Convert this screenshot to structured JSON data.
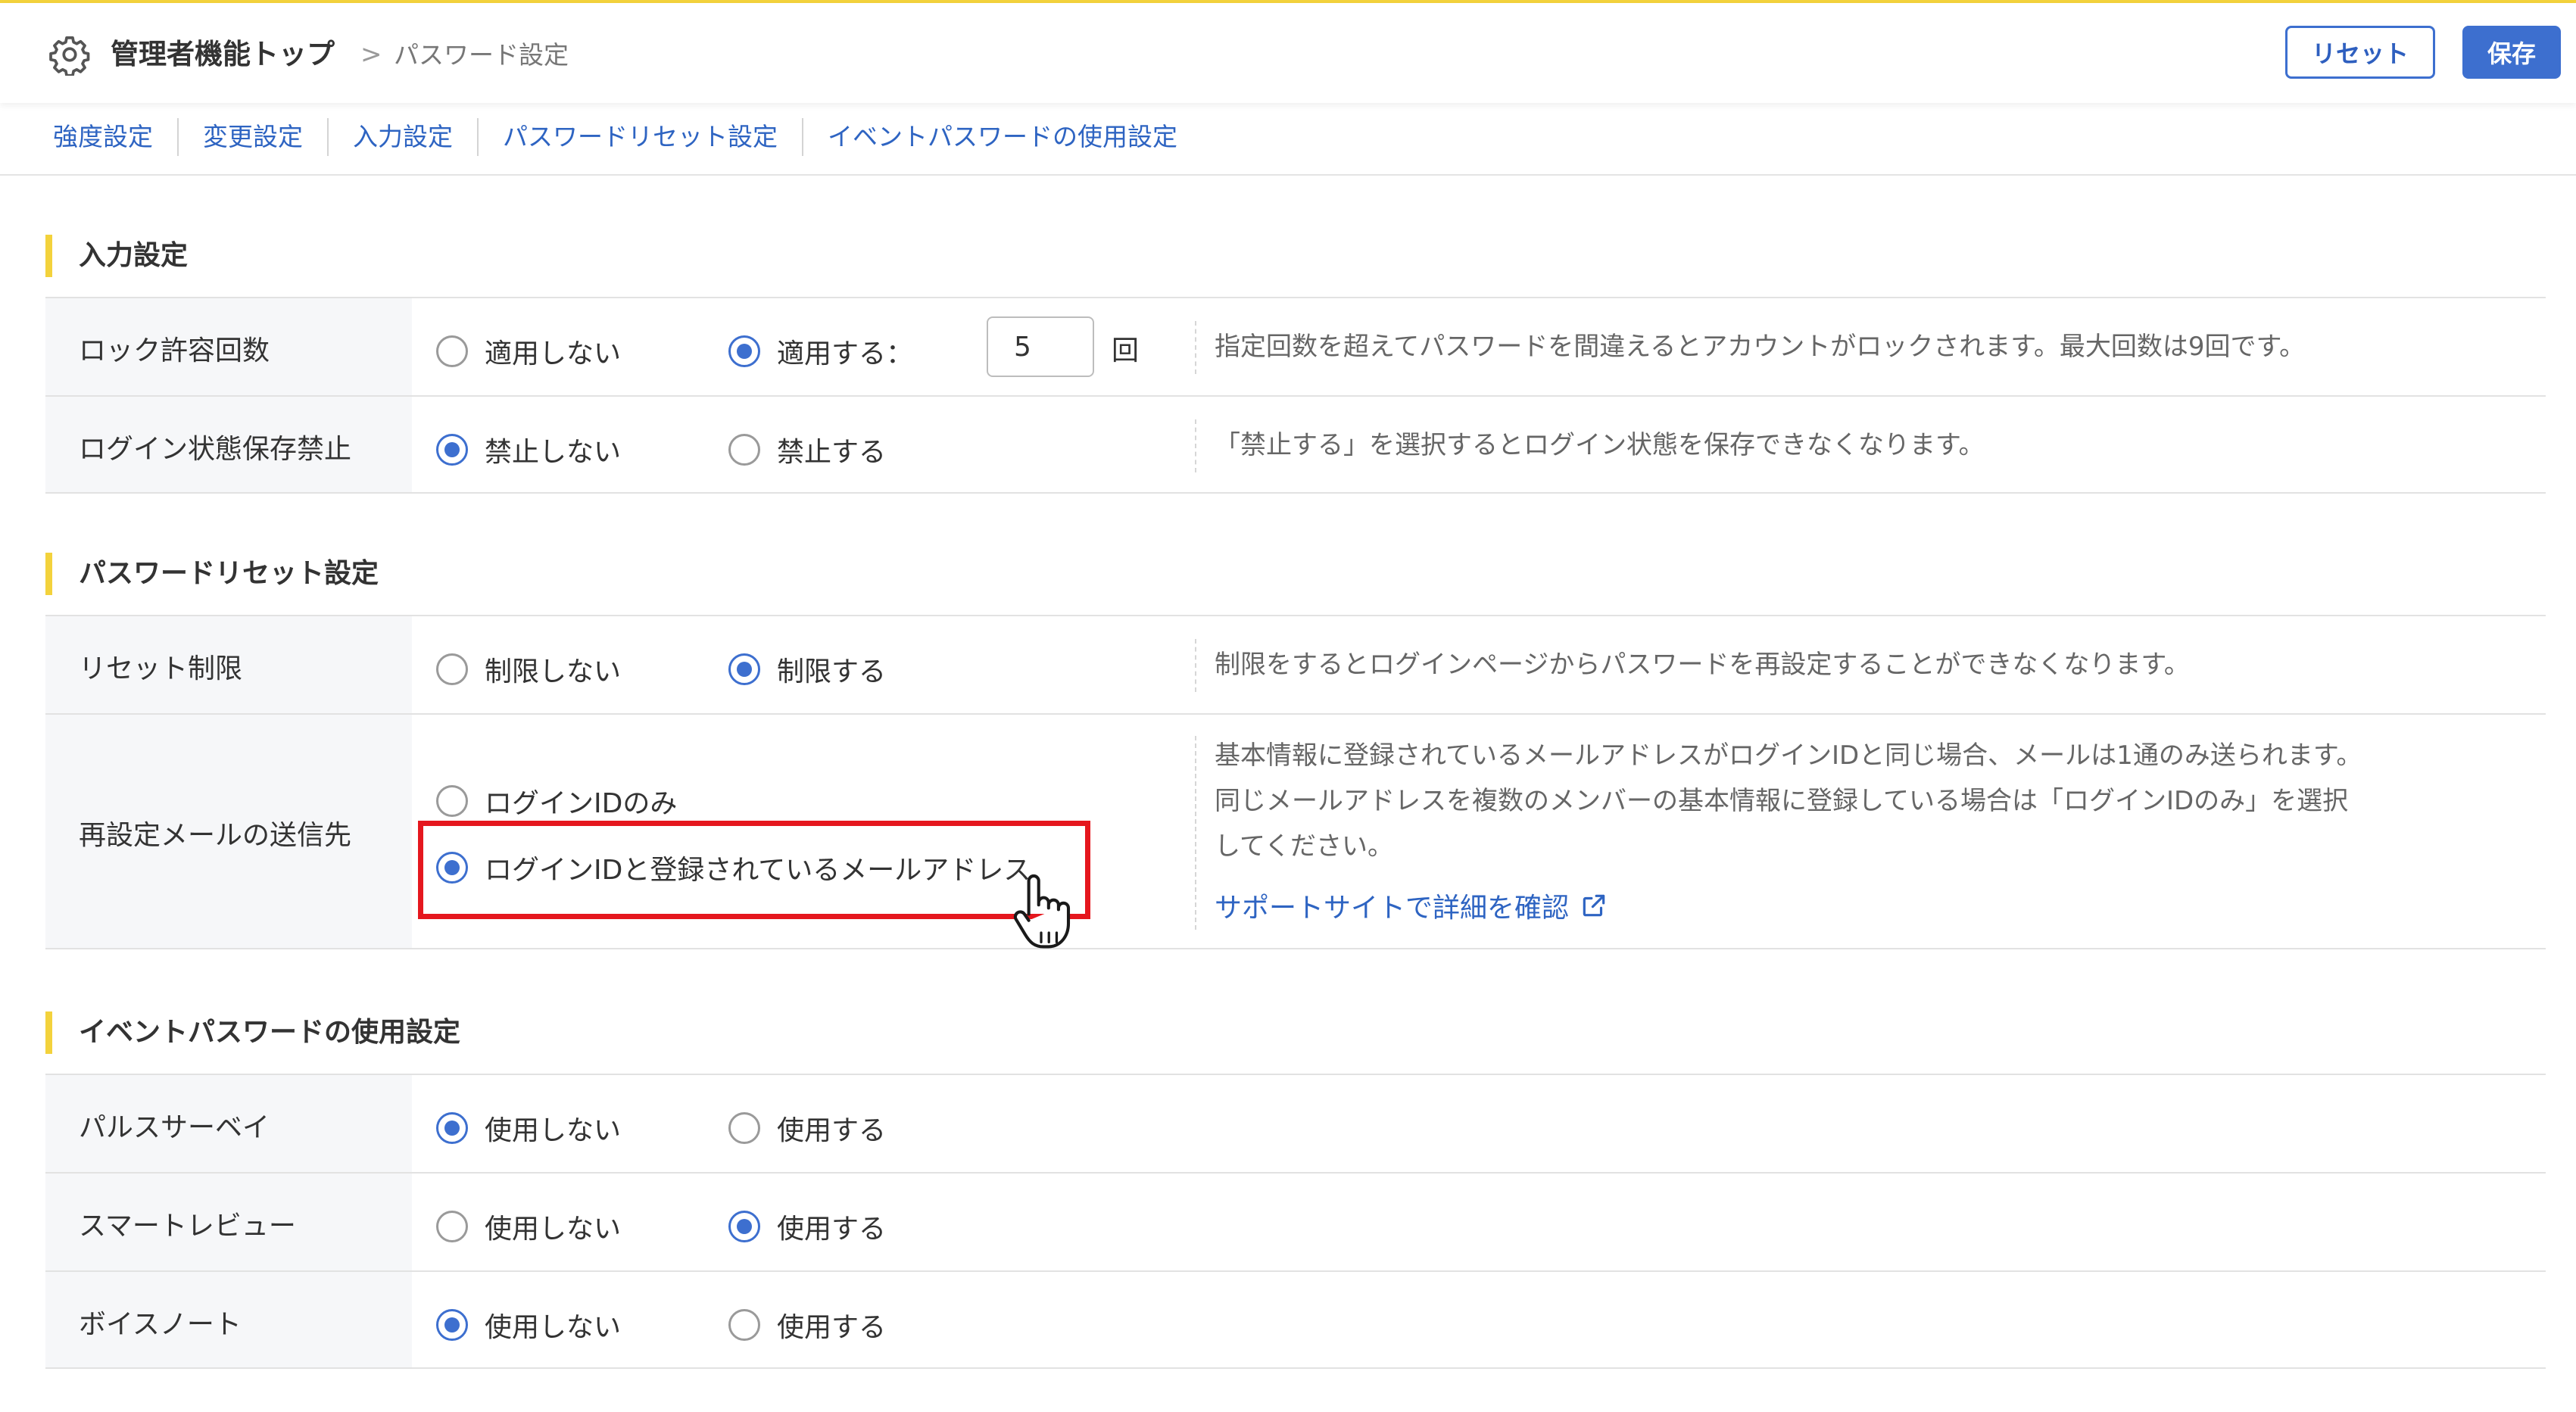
{
  "header": {
    "title": "管理者機能トップ",
    "separator": ">",
    "current_page": "パスワード設定",
    "reset_label": "リセット",
    "save_label": "保存"
  },
  "tabs": [
    {
      "label": "強度設定"
    },
    {
      "label": "変更設定"
    },
    {
      "label": "入力設定"
    },
    {
      "label": "パスワードリセット設定"
    },
    {
      "label": "イベントパスワードの使用設定"
    }
  ],
  "sections": {
    "input": {
      "title": "入力設定",
      "lock": {
        "label": "ロック許容回数",
        "opt_off": "適用しない",
        "opt_on": "適用する：",
        "selected": "opt_on",
        "value": "5",
        "unit": "回",
        "desc": "指定回数を超えてパスワードを間違えるとアカウントがロックされます。最大回数は9回です。"
      },
      "login_save": {
        "label": "ログイン状態保存禁止",
        "opt_off": "禁止しない",
        "opt_on": "禁止する",
        "selected": "opt_off",
        "desc": "「禁止する」を選択するとログイン状態を保存できなくなります。"
      }
    },
    "reset": {
      "title": "パスワードリセット設定",
      "limit": {
        "label": "リセット制限",
        "opt_off": "制限しない",
        "opt_on": "制限する",
        "selected": "opt_on",
        "desc": "制限をするとログインページからパスワードを再設定することができなくなります。"
      },
      "mail": {
        "label": "再設定メールの送信先",
        "opt_login_only": "ログインIDのみ",
        "opt_login_and_mail": "ログインIDと登録されているメールアドレス",
        "selected": "opt_login_and_mail",
        "desc_line1": "基本情報に登録されているメールアドレスがログインIDと同じ場合、メールは1通のみ送られます。",
        "desc_line2": "同じメールアドレスを複数のメンバーの基本情報に登録している場合は「ログインIDのみ」を選択",
        "desc_line3": "してください。",
        "link": "サポートサイトで詳細を確認"
      }
    },
    "event": {
      "title": "イベントパスワードの使用設定",
      "pulse": {
        "label": "パルスサーベイ",
        "opt_off": "使用しない",
        "opt_on": "使用する",
        "selected": "opt_off"
      },
      "smart": {
        "label": "スマートレビュー",
        "opt_off": "使用しない",
        "opt_on": "使用する",
        "selected": "opt_on"
      },
      "voice": {
        "label": "ボイスノート",
        "opt_off": "使用しない",
        "opt_on": "使用する",
        "selected": "opt_off"
      }
    }
  },
  "colors": {
    "accent": "#3d6fcf",
    "link": "#2e64c2",
    "section_marker": "#f3d23c",
    "highlight": "#e5171e"
  }
}
